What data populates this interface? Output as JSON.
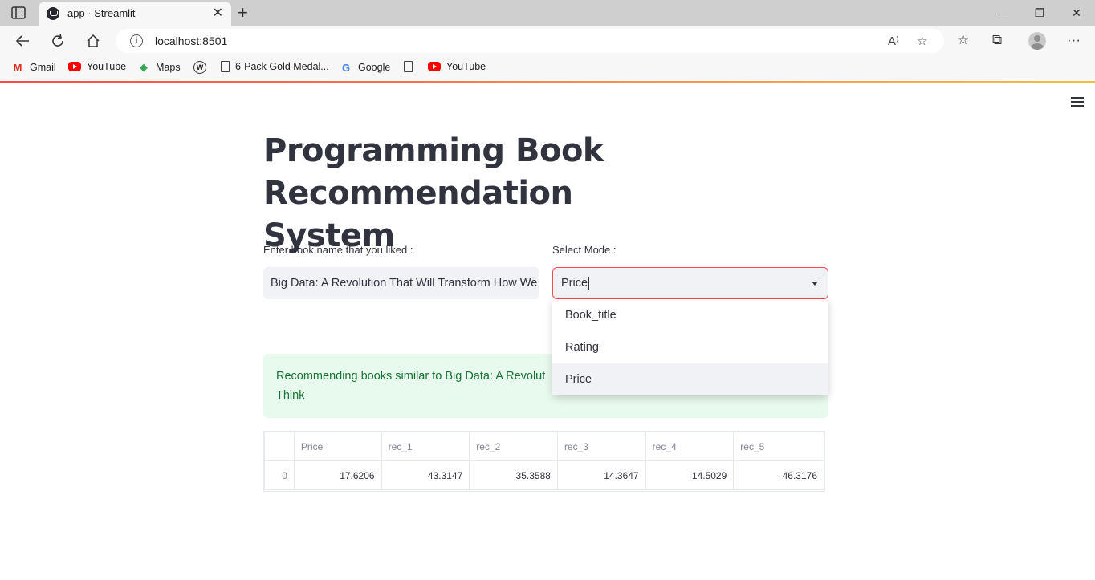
{
  "browser": {
    "tab_title": "app · Streamlit",
    "url": "localhost:8501",
    "bookmarks": [
      {
        "label": "Gmail",
        "icon": "gmail-icon"
      },
      {
        "label": "YouTube",
        "icon": "youtube-icon"
      },
      {
        "label": "Maps",
        "icon": "maps-icon"
      },
      {
        "label": "",
        "icon": "wikipedia-icon"
      },
      {
        "label": "6-Pack Gold Medal...",
        "icon": "document-icon"
      },
      {
        "label": "Google",
        "icon": "google-icon"
      },
      {
        "label": "",
        "icon": "document-icon"
      },
      {
        "label": "YouTube",
        "icon": "youtube-icon"
      }
    ]
  },
  "app": {
    "title": "Programming Book Recommendation System",
    "book_input": {
      "label": "Enter book name that you liked :",
      "value": "Big Data: A Revolution That Will Transform How We Live, Work, and Think"
    },
    "mode_select": {
      "label": "Select Mode :",
      "value": "Price",
      "options": [
        "Book_title",
        "Rating",
        "Price"
      ],
      "highlighted": "Price"
    },
    "alert": {
      "text": "Recommending books similar to Big Data: A Revolution That Will Transform How We Live, Work, and Think",
      "visible_line1": "Recommending books similar to Big Data: A Revolut",
      "visible_line2": "Think",
      "color": "#177233",
      "background": "#e8f9ee"
    },
    "table": {
      "columns": [
        "Price",
        "rec_1",
        "rec_2",
        "rec_3",
        "rec_4",
        "rec_5"
      ],
      "rows": [
        {
          "index": "0",
          "values": [
            "17.6206",
            "43.3147",
            "35.3588",
            "14.3647",
            "14.5029",
            "46.3176"
          ]
        }
      ]
    }
  },
  "colors": {
    "primary": "#ff4b4b",
    "text": "#31333f",
    "input_bg": "#f0f2f6"
  }
}
